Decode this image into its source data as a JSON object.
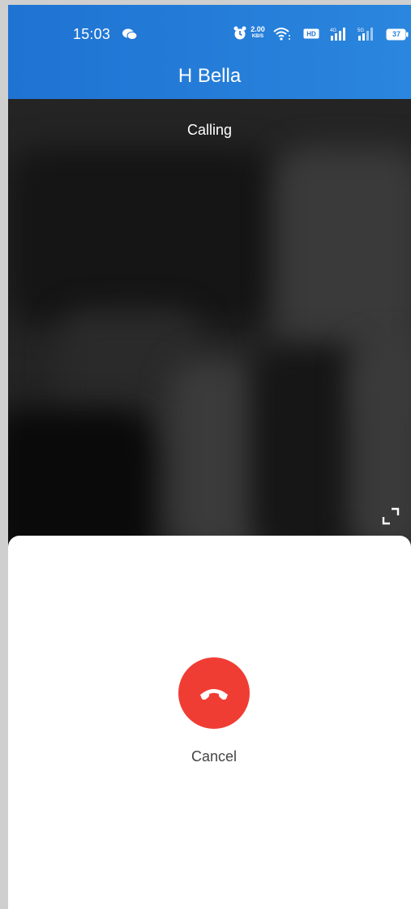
{
  "status_bar": {
    "time": "15:03",
    "network_speed": "2.00",
    "network_speed_unit": "KB/S",
    "battery_level": "37",
    "icons": [
      "wechat-icon",
      "alarm-icon",
      "wifi-icon",
      "hd-icon",
      "4g-signal-icon",
      "5g-signal-icon",
      "battery-icon"
    ]
  },
  "header": {
    "title": "H Bella"
  },
  "call": {
    "status": "Calling",
    "cancel_label": "Cancel"
  },
  "colors": {
    "header_bg": "#2a86de",
    "cancel_red": "#f03d33",
    "video_bg": "#242424",
    "sheet_bg": "#ffffff"
  }
}
